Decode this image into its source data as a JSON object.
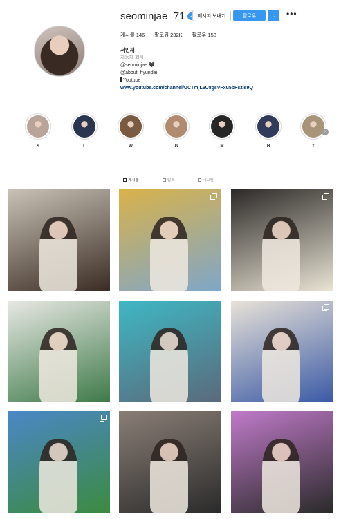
{
  "profile": {
    "username": "seominjae_71",
    "verified_mark": "✓",
    "message_button": "메시지 보내기",
    "follow_button": "팔로우",
    "more_button": "⌄",
    "options": "•••",
    "stats": {
      "posts": "게시물 146",
      "followers": "팔로워 232K",
      "following": "팔로우 158"
    },
    "bio": {
      "name": "서민재",
      "category": "자동차 회사",
      "handle": "@seominjae 🖤",
      "company": "@about_hyundai",
      "youtube_label": "Youtube",
      "link": "www.youtube.com/channel/UCTmjL6U8gsVFxu5bFczls9Q"
    }
  },
  "highlights": [
    {
      "label": "S",
      "color": "#b9a49a"
    },
    {
      "label": "L",
      "color": "#2a3550"
    },
    {
      "label": "W",
      "color": "#7a5a40"
    },
    {
      "label": "G",
      "color": "#b08b70"
    },
    {
      "label": "M",
      "color": "#262626"
    },
    {
      "label": "H",
      "color": "#303a5a"
    },
    {
      "label": "T",
      "color": "#a89478"
    }
  ],
  "highlights_next_icon": "›",
  "tabs": [
    {
      "label": "게시물",
      "active": true
    },
    {
      "label": "릴스",
      "active": false
    },
    {
      "label": "태그됨",
      "active": false
    }
  ],
  "posts": [
    {
      "bg": "#c9c2b6",
      "accent": "#3a2c24",
      "multi": false
    },
    {
      "bg": "#d9b24a",
      "accent": "#7fa6c9",
      "multi": true
    },
    {
      "bg": "#2c2a28",
      "accent": "#e9e3d4",
      "multi": true
    },
    {
      "bg": "#e8e8e4",
      "accent": "#3e7a48",
      "multi": false
    },
    {
      "bg": "#3fb7c4",
      "accent": "#5a6a7a",
      "multi": false
    },
    {
      "bg": "#e8e2d8",
      "accent": "#3b5aa6",
      "multi": true
    },
    {
      "bg": "#4a87c7",
      "accent": "#3c8a40",
      "multi": true
    },
    {
      "bg": "#8a7e76",
      "accent": "#2b2b2b",
      "multi": false
    },
    {
      "bg": "#c07ac9",
      "accent": "#2a2a2a",
      "multi": false
    }
  ]
}
